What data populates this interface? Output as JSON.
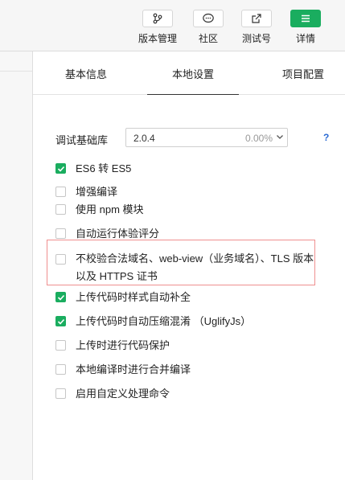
{
  "toolbar": {
    "items": [
      {
        "label": "版本管理",
        "icon": "branch-icon"
      },
      {
        "label": "社区",
        "icon": "chat-bubble-icon"
      },
      {
        "label": "测试号",
        "icon": "external-link-icon"
      },
      {
        "label": "详情",
        "icon": "menu-icon"
      }
    ]
  },
  "tabs": [
    "基本信息",
    "本地设置",
    "项目配置"
  ],
  "active_tab": "本地设置",
  "debug_lib": {
    "label": "调试基础库",
    "version": "2.0.4",
    "percent": "0.00%",
    "help": "?"
  },
  "options": [
    {
      "label": "ES6 转 ES5",
      "checked": true
    },
    {
      "label": "增强编译",
      "checked": false
    },
    {
      "label": "使用 npm 模块",
      "checked": false
    },
    {
      "label": "自动运行体验评分",
      "checked": false
    },
    {
      "label": "不校验合法域名、web-view（业务域名）、TLS 版本以及 HTTPS 证书",
      "checked": false
    },
    {
      "label": "上传代码时样式自动补全",
      "checked": true
    },
    {
      "label": "上传代码时自动压缩混淆 （UglifyJs）",
      "checked": true
    },
    {
      "label": "上传时进行代码保护",
      "checked": false
    },
    {
      "label": "本地编译时进行合并编译",
      "checked": false
    },
    {
      "label": "启用自定义处理命令",
      "checked": false
    }
  ],
  "colors": {
    "accent": "#1aad5f",
    "highlight": "#ef8f8f",
    "link": "#2a6ad3"
  }
}
